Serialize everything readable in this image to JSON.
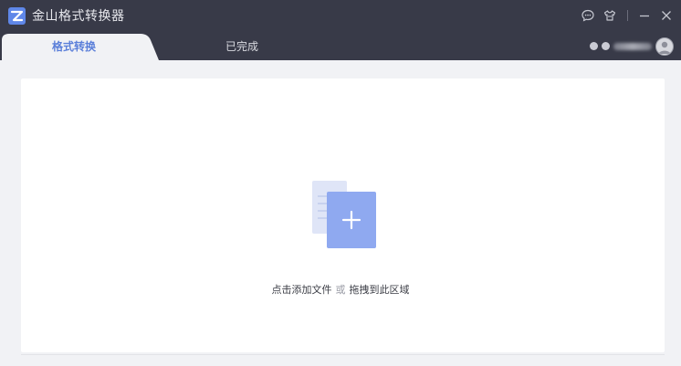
{
  "app": {
    "title": "金山格式转换器",
    "logo_icon": "kingsoft-z-logo-icon"
  },
  "window_controls": {
    "feedback_icon": "chat-bubble-icon",
    "skin_icon": "shirt-icon",
    "minimize_icon": "minimize-icon",
    "close_icon": "close-icon"
  },
  "tabs": [
    {
      "label": "格式转换",
      "active": true
    },
    {
      "label": "已完成",
      "active": false
    }
  ],
  "user": {
    "avatar_icon": "user-avatar-icon",
    "status_icons": [
      "settings-dot-icon",
      "settings-dot-icon"
    ]
  },
  "drop_zone": {
    "add_icon": "add-file-icon",
    "hint_click": "点击添加文件",
    "hint_or": "或",
    "hint_drag": "拖拽到此区域"
  },
  "colors": {
    "titlebar_bg": "#383a48",
    "accent": "#5b7fd9",
    "file_front": "#8fa9f0",
    "file_back": "#dfe5f7",
    "content_bg": "#f1f2f5"
  }
}
